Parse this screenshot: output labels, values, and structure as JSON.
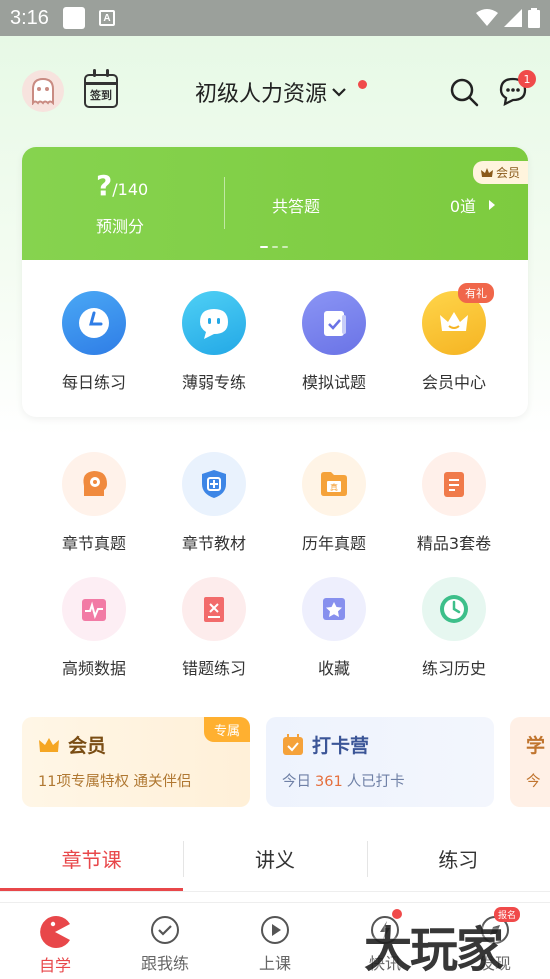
{
  "status": {
    "time": "3:16"
  },
  "header": {
    "title": "初级人力资源",
    "checkin_label": "签到",
    "message_count": "1"
  },
  "summary": {
    "score_value": "?",
    "score_total": "/140",
    "score_label": "预测分",
    "answers_label": "共答题",
    "answers_value": "0道",
    "vip_tag": "会员"
  },
  "quick_actions": [
    {
      "label": "每日练习",
      "icon": "clock-icon"
    },
    {
      "label": "薄弱专练",
      "icon": "chat-face-icon"
    },
    {
      "label": "模拟试题",
      "icon": "paper-icon"
    },
    {
      "label": "会员中心",
      "icon": "crown-icon",
      "tag": "有礼"
    }
  ],
  "features_row1": [
    {
      "label": "章节真题",
      "icon": "head-gear-icon"
    },
    {
      "label": "章节教材",
      "icon": "shield-plus-icon"
    },
    {
      "label": "历年真题",
      "icon": "folder-zhen-icon"
    },
    {
      "label": "精品3套卷",
      "icon": "clipboard-icon"
    }
  ],
  "features_row2": [
    {
      "label": "高频数据",
      "icon": "pulse-icon"
    },
    {
      "label": "错题练习",
      "icon": "book-x-icon"
    },
    {
      "label": "收藏",
      "icon": "star-box-icon"
    },
    {
      "label": "练习历史",
      "icon": "history-clock-icon"
    }
  ],
  "promos": {
    "vip": {
      "title": "会员",
      "subtitle": "11项专属特权  通关伴侣",
      "tag": "专属"
    },
    "punch": {
      "title": "打卡营",
      "prefix": "今日",
      "count": "361",
      "suffix": "人已打卡"
    },
    "study": {
      "title": "学",
      "subtitle": "今"
    }
  },
  "tabs": [
    {
      "label": "章节课",
      "active": true
    },
    {
      "label": "讲义",
      "active": false
    },
    {
      "label": "练习",
      "active": false
    }
  ],
  "bottom_nav": [
    {
      "label": "自学",
      "active": true
    },
    {
      "label": "跟我练",
      "active": false
    },
    {
      "label": "上课",
      "active": false
    },
    {
      "label": "快讯",
      "active": false
    },
    {
      "label": "发现",
      "active": false,
      "badge": "报名"
    }
  ],
  "watermark": "大玩家",
  "colors": {
    "accent": "#e8474a",
    "green": "#7dcb3f"
  }
}
